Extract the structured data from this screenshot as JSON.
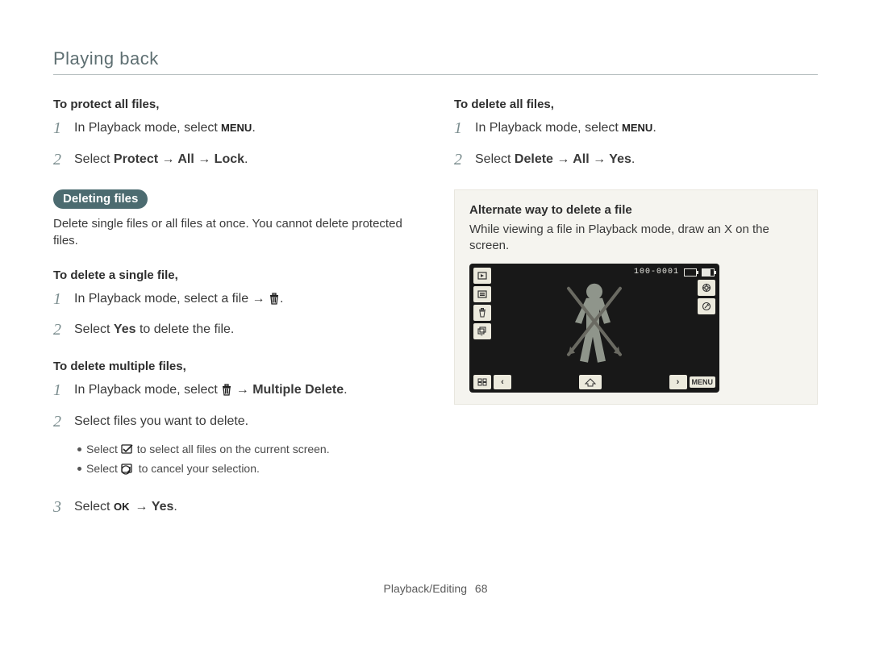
{
  "header": "Playing back",
  "footer": {
    "section": "Playback/Editing",
    "page": "68"
  },
  "icons": {
    "menu": "MENU",
    "trash": "trash-icon",
    "select_all": "select-all-icon",
    "deselect": "deselect-icon",
    "ok": "OK"
  },
  "left": {
    "protect_all": {
      "title": "To protect all files,",
      "step1_prefix": "In Playback mode, select ",
      "step1_suffix": ".",
      "step2_prefix": "Select ",
      "step2_path": "Protect → All → Lock",
      "step2_suffix": "."
    },
    "deleting_badge": "Deleting files",
    "deleting_desc": "Delete single files or all files at once. You cannot delete protected files.",
    "single": {
      "title": "To delete a single file,",
      "step1_prefix": "In Playback mode, select a file → ",
      "step1_suffix": ".",
      "step2_prefix": "Select ",
      "step2_yes": "Yes",
      "step2_suffix": " to delete the file."
    },
    "multiple": {
      "title": "To delete multiple files,",
      "step1_prefix": "In Playback mode, select ",
      "step1_mid": " → ",
      "step1_path": "Multiple Delete",
      "step1_suffix": ".",
      "step2": "Select files you want to delete.",
      "bullet1_prefix": "Select ",
      "bullet1_suffix": " to select all files on the current screen.",
      "bullet2_prefix": "Select ",
      "bullet2_suffix": " to cancel your selection.",
      "step3_prefix": "Select ",
      "step3_mid": " → ",
      "step3_yes": "Yes",
      "step3_suffix": "."
    }
  },
  "right": {
    "delete_all": {
      "title": "To delete all files,",
      "step1_prefix": "In Playback mode, select ",
      "step1_suffix": ".",
      "step2_prefix": "Select ",
      "step2_path": "Delete → All → Yes",
      "step2_suffix": "."
    },
    "alt": {
      "title": "Alternate way to delete a file",
      "desc": "While viewing a file in Playback mode, draw an X on the screen."
    },
    "preview": {
      "counter": "100-0001"
    }
  }
}
